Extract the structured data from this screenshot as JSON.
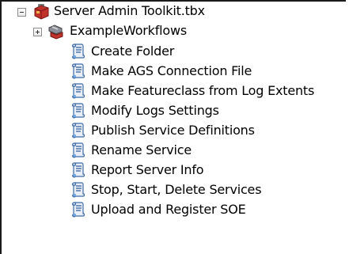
{
  "tree": {
    "toolbox": {
      "label": "Server Admin Toolkit.tbx",
      "icon": "toolbox-icon",
      "expanded": true
    },
    "toolset": {
      "label": "ExampleWorkflows",
      "icon": "toolset-icon",
      "expanded": false
    },
    "scripts": [
      {
        "label": "Create Folder",
        "icon": "script-tool-icon"
      },
      {
        "label": "Make AGS Connection File",
        "icon": "script-tool-icon"
      },
      {
        "label": "Make Featureclass from Log Extents",
        "icon": "script-tool-icon"
      },
      {
        "label": "Modify Logs Settings",
        "icon": "script-tool-icon"
      },
      {
        "label": "Publish Service Definitions",
        "icon": "script-tool-icon"
      },
      {
        "label": "Rename Service",
        "icon": "script-tool-icon"
      },
      {
        "label": "Report Server Info",
        "icon": "script-tool-icon"
      },
      {
        "label": "Stop, Start, Delete Services",
        "icon": "script-tool-icon"
      },
      {
        "label": "Upload and Register SOE",
        "icon": "script-tool-icon"
      }
    ]
  }
}
